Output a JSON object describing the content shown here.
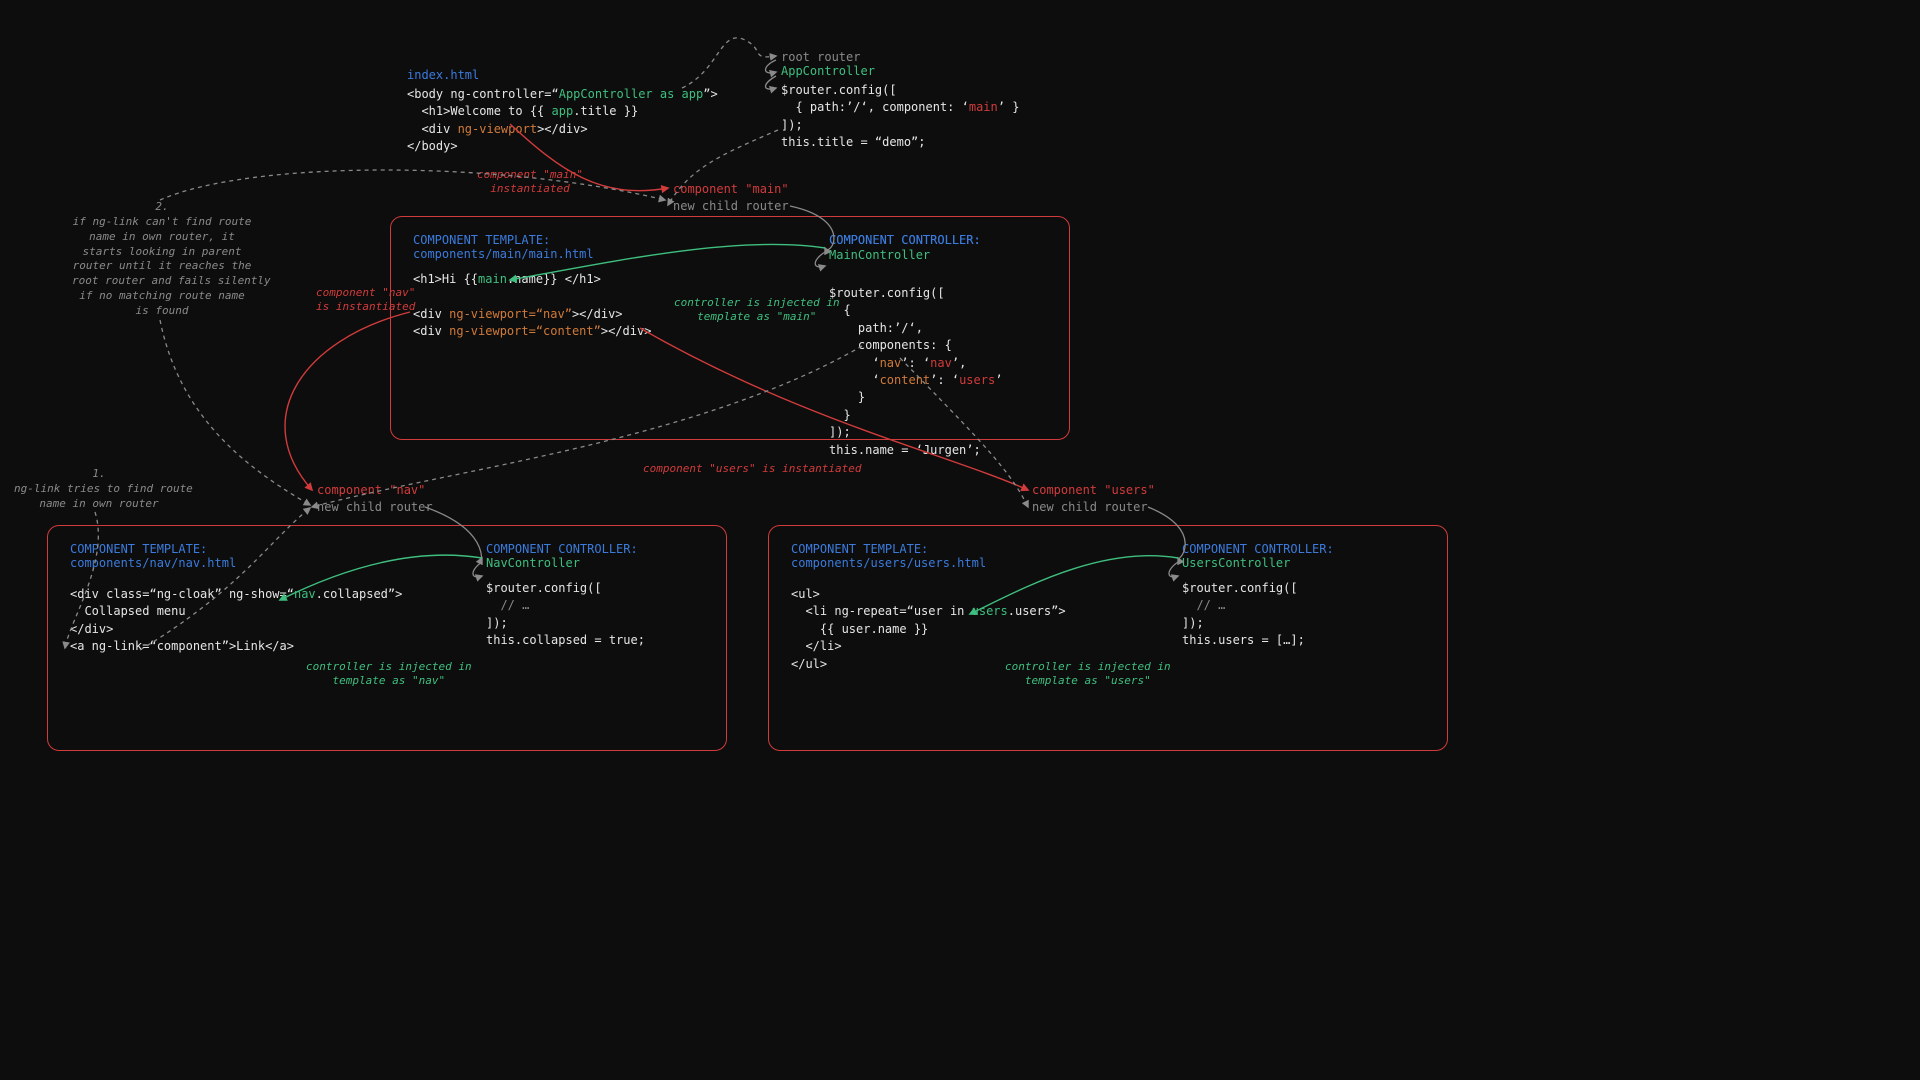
{
  "index_html": {
    "title": "index.html",
    "code_html": "<span class='c-white'>&lt;body ng-controller=&#8220;</span><span class='c-green'>AppController as app</span><span class='c-white'>&#8221;&gt;</span>\n<span class='c-white'>  &lt;h1&gt;Welcome to {{ </span><span class='c-green'>app</span><span class='c-white'>.title }}</span>\n<span class='c-white'>  &lt;div </span><span class='c-orange'>ng-viewport</span><span class='c-white'>&gt;&lt;/div&gt;</span>\n<span class='c-white'>&lt;/body&gt;</span>"
  },
  "root_router": {
    "line1": "root router",
    "line2": "AppController",
    "code_html": "<span class='c-white'>$router.config([</span>\n<span class='c-white'>  { path:&#8217;/&#8216;, component: &#8216;</span><span class='c-red'>main</span><span class='c-white'>&#8217; }</span>\n<span class='c-white'>]);</span>\n<span class='c-white'>this.title = &#8220;demo&#8221;;</span>"
  },
  "labels": {
    "component_main_inst": "component \"main\"\ninstantiated",
    "component_main": "component \"main\"",
    "new_child_router_top": "new child router",
    "note1": "1.\nng-link tries to find route\nname in own router",
    "note2": "2.\nif ng-link can't find route\nname in own router, it\nstarts looking in parent\nrouter until it reaches the\nroot router and fails silently\nif no matching route name\nis found",
    "component_nav_inst": "component \"nav\"\nis instantiated",
    "component_users_inst": "component \"users\" is instantiated",
    "ctrl_injected_main": "controller is injected in\ntemplate as \"main\"",
    "component_nav": "component \"nav\"",
    "new_child_router_nav": "new child router",
    "ctrl_injected_nav": "controller is injected in\ntemplate as \"nav\"",
    "component_users": "component \"users\"",
    "new_child_router_users": "new child router",
    "ctrl_injected_users": "controller is injected in\ntemplate as \"users\""
  },
  "box_main": {
    "tpl_heading": "COMPONENT TEMPLATE:\ncomponents/main/main.html",
    "tpl_code_html": "<span class='c-white'>&lt;h1&gt;Hi {{</span><span class='c-green'>main</span><span class='c-white'>.name}} &lt;/h1&gt;</span>\n\n<span class='c-white'>&lt;div </span><span class='c-orange'>ng-viewport=&#8220;nav&#8221;</span><span class='c-white'>&gt;&lt;/div&gt;</span>\n<span class='c-white'>&lt;div </span><span class='c-orange'>ng-viewport=&#8220;content&#8221;</span><span class='c-white'>&gt;&lt;/div&gt;</span>",
    "ctrl_heading": "COMPONENT CONTROLLER:\nMainController",
    "ctrl_code_html": "<span class='c-white'>$router.config([</span>\n<span class='c-white'>  {</span>\n<span class='c-white'>    path:&#8217;/&#8216;,</span>\n<span class='c-white'>    components: {</span>\n<span class='c-white'>      &#8216;</span><span class='c-orange'>nav</span><span class='c-white'>&#8217;: &#8216;</span><span class='c-red'>nav</span><span class='c-white'>&#8217;,</span>\n<span class='c-white'>      &#8216;</span><span class='c-orange'>content</span><span class='c-white'>&#8217;: &#8216;</span><span class='c-red'>users</span><span class='c-white'>&#8217;</span>\n<span class='c-white'>    }</span>\n<span class='c-white'>  }</span>\n<span class='c-white'>]);</span>\n<span class='c-white'>this.name = &#8216;Jurgen&#8217;;</span>"
  },
  "box_nav": {
    "tpl_heading": "COMPONENT TEMPLATE:\ncomponents/nav/nav.html",
    "tpl_code_html": "<span class='c-white'>&lt;div class=&#8220;ng-cloak&#8221; ng-show=&#8220;</span><span class='c-green'>nav</span><span class='c-white'>.collapsed&#8221;&gt;</span>\n<span class='c-white'>  Collapsed menu</span>\n<span class='c-white'>&lt;/div&gt;</span>\n<span class='c-white'>&lt;a ng-link=&#8220;component&#8221;&gt;Link&lt;/a&gt;</span>",
    "ctrl_heading": "COMPONENT CONTROLLER:\nNavController",
    "ctrl_code_html": "<span class='c-white'>$router.config([</span>\n<span class='c-gray'>  // &#8230;</span>\n<span class='c-white'>]);</span>\n<span class='c-white'>this.collapsed = true;</span>"
  },
  "box_users": {
    "tpl_heading": "COMPONENT TEMPLATE:\ncomponents/users/users.html",
    "tpl_code_html": "<span class='c-white'>&lt;ul&gt;</span>\n<span class='c-white'>  &lt;li ng-repeat=&#8220;user in </span><span class='c-green'>users</span><span class='c-white'>.users&#8221;&gt;</span>\n<span class='c-white'>    {{ user.name }}</span>\n<span class='c-white'>  &lt;/li&gt;</span>\n<span class='c-white'>&lt;/ul&gt;</span>",
    "ctrl_heading": "COMPONENT CONTROLLER:\nUsersController",
    "ctrl_code_html": "<span class='c-white'>$router.config([</span>\n<span class='c-gray'>  // &#8230;</span>\n<span class='c-white'>]);</span>\n<span class='c-white'>this.users = [&#8230;];</span>"
  }
}
